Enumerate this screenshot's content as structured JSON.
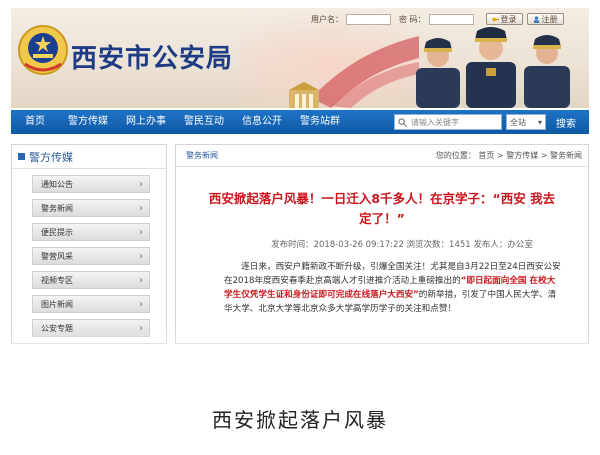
{
  "header": {
    "site_title": "西安市公安局",
    "login": {
      "username_label": "用户名：",
      "password_label": "密 码：",
      "login_button": "登录",
      "register_button": "注册"
    }
  },
  "nav": {
    "items": [
      {
        "label": "首页"
      },
      {
        "label": "警方传媒"
      },
      {
        "label": "网上办事"
      },
      {
        "label": "警民互动"
      },
      {
        "label": "信息公开"
      },
      {
        "label": "警务站群"
      }
    ],
    "search": {
      "placeholder": "请输入关键字",
      "scope": "全站",
      "button": "搜索"
    }
  },
  "sidebar": {
    "title": "警方传媒",
    "items": [
      {
        "label": "通知公告"
      },
      {
        "label": "警务新闻"
      },
      {
        "label": "便民提示"
      },
      {
        "label": "警营风采"
      },
      {
        "label": "视频专区"
      },
      {
        "label": "图片新闻"
      },
      {
        "label": "公安专题"
      }
    ]
  },
  "main": {
    "section": "警务新闻",
    "breadcrumb": {
      "prefix": "您的位置：",
      "home": "首页",
      "sep1": ">",
      "level1": "警方传媒",
      "sep2": ">",
      "level2": "警务新闻"
    },
    "article": {
      "title": "西安掀起落户风暴！一日迁入8千多人！在京学子：“西安 我去定了！”",
      "meta": "发布时间：2018-03-26 09:17:22  浏览次数：1451  发布人：办公室",
      "body_pre": "连日来，西安户籍新政不断升级，引爆全国关注！尤其是自3月22日至24日西安公安在2018年度西安春季赴京高端人才引进推介活动上重磅推出的",
      "body_highlight": "“即日起面向全国 在校大学生仅凭学生证和身份证即可完成在线落户大西安”",
      "body_post": "的新举措，引发了中国人民大学、清华大学、北京大学等北京众多大学高学历学子的关注和点赞！"
    }
  },
  "caption": "西安掀起落户风暴",
  "colors": {
    "nav_blue": "#1569bb",
    "title_blue": "#1e3c86",
    "headline_red": "#c9161d"
  }
}
